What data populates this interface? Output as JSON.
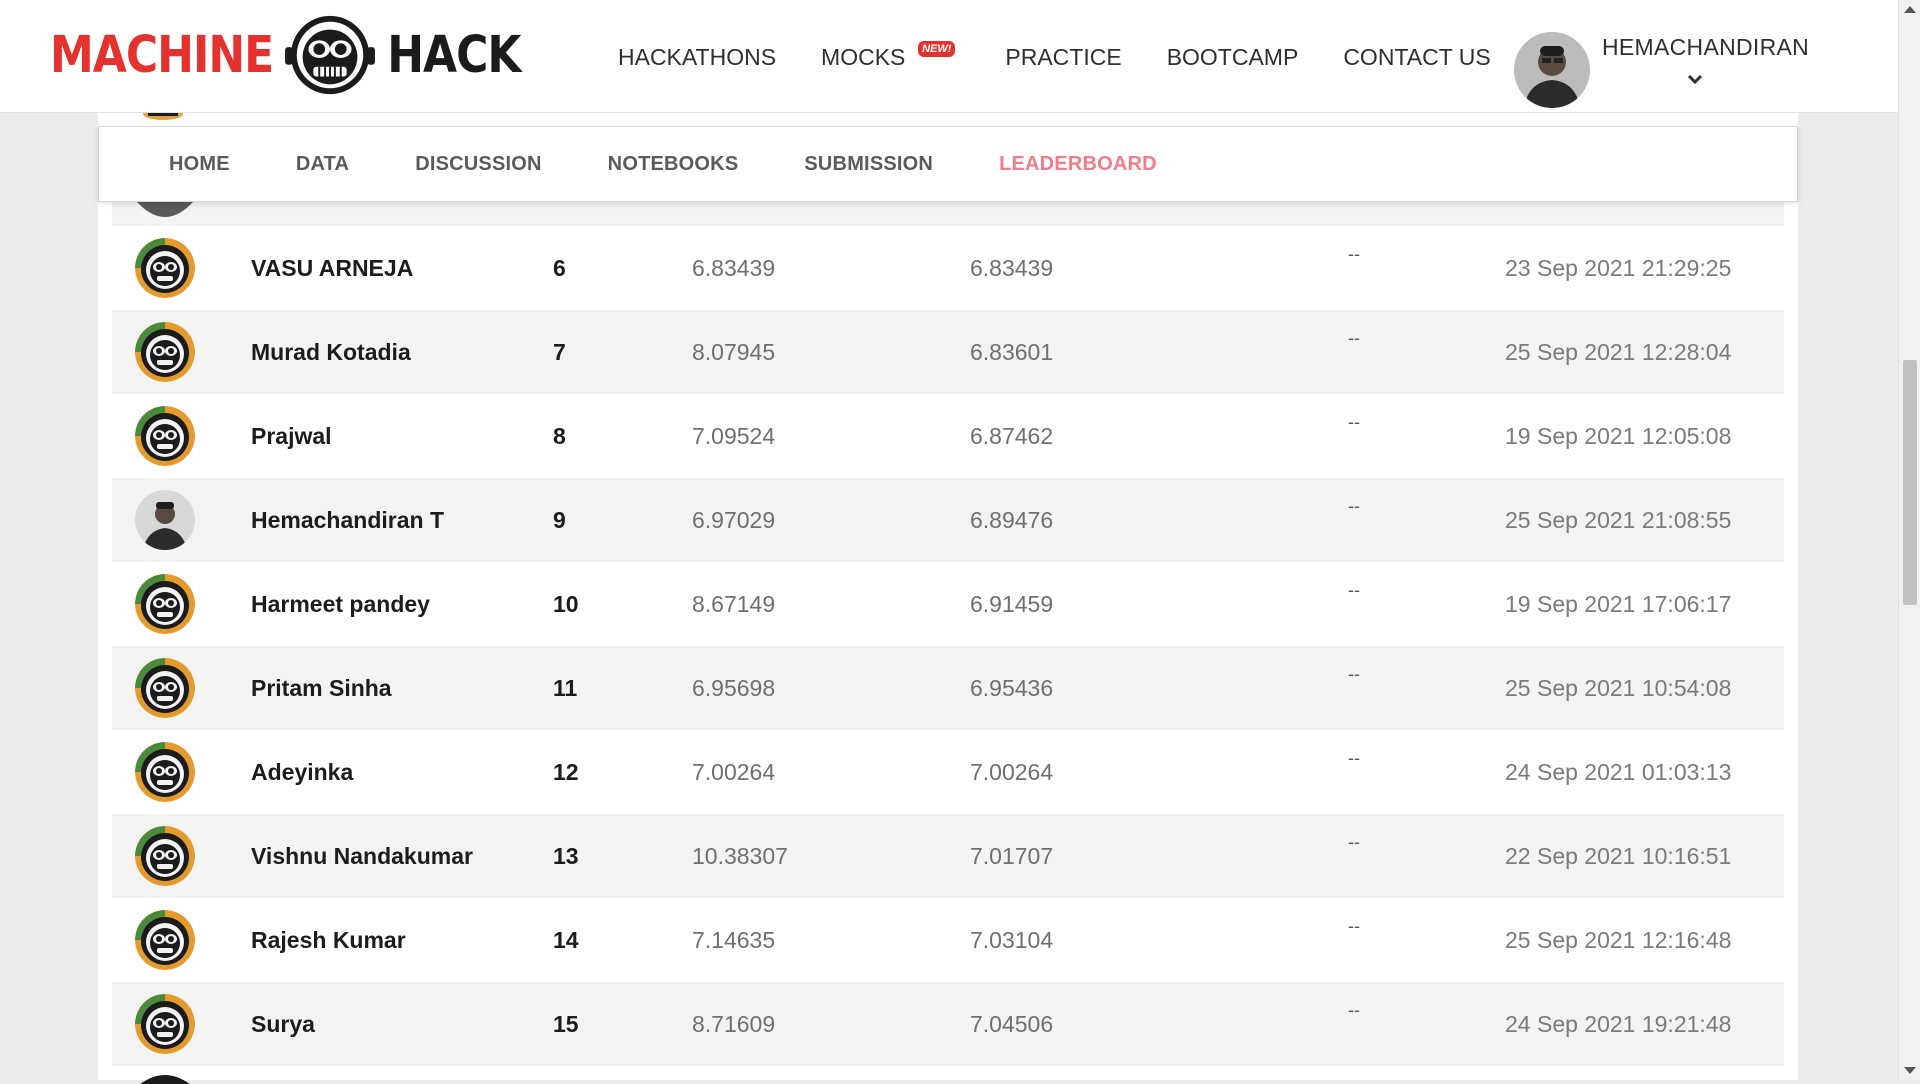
{
  "brand": {
    "name_left": "MACHINE",
    "name_right": "HACK"
  },
  "nav": {
    "items": [
      "HACKATHONS",
      "MOCKS",
      "PRACTICE",
      "BOOTCAMP",
      "CONTACT US"
    ],
    "mocks_badge": "NEW!"
  },
  "user": {
    "name": "HEMACHANDIRAN"
  },
  "tabs": {
    "items": [
      "HOME",
      "DATA",
      "DISCUSSION",
      "NOTEBOOKS",
      "SUBMISSION",
      "LEADERBOARD"
    ],
    "active": "LEADERBOARD"
  },
  "leaderboard": {
    "rows": [
      {
        "name": "VASU ARNEJA",
        "rank": "6",
        "public_score": "6.83439",
        "private_score": "6.83439",
        "notebook": "--",
        "submitted": "23 Sep 2021 21:29:25",
        "avatar": "mh-default-avatar"
      },
      {
        "name": "Murad Kotadia",
        "rank": "7",
        "public_score": "8.07945",
        "private_score": "6.83601",
        "notebook": "--",
        "submitted": "25 Sep 2021 12:28:04",
        "avatar": "mh-default-avatar"
      },
      {
        "name": "Prajwal",
        "rank": "8",
        "public_score": "7.09524",
        "private_score": "6.87462",
        "notebook": "--",
        "submitted": "19 Sep 2021 12:05:08",
        "avatar": "mh-default-avatar"
      },
      {
        "name": "Hemachandiran T",
        "rank": "9",
        "public_score": "6.97029",
        "private_score": "6.89476",
        "notebook": "--",
        "submitted": "25 Sep 2021 21:08:55",
        "avatar": "user-photo"
      },
      {
        "name": "Harmeet pandey",
        "rank": "10",
        "public_score": "8.67149",
        "private_score": "6.91459",
        "notebook": "--",
        "submitted": "19 Sep 2021 17:06:17",
        "avatar": "mh-default-avatar"
      },
      {
        "name": "Pritam Sinha",
        "rank": "11",
        "public_score": "6.95698",
        "private_score": "6.95436",
        "notebook": "--",
        "submitted": "25 Sep 2021 10:54:08",
        "avatar": "mh-default-avatar"
      },
      {
        "name": "Adeyinka",
        "rank": "12",
        "public_score": "7.00264",
        "private_score": "7.00264",
        "notebook": "--",
        "submitted": "24 Sep 2021 01:03:13",
        "avatar": "mh-default-avatar"
      },
      {
        "name": "Vishnu Nandakumar",
        "rank": "13",
        "public_score": "10.38307",
        "private_score": "7.01707",
        "notebook": "--",
        "submitted": "22 Sep 2021 10:16:51",
        "avatar": "mh-default-avatar"
      },
      {
        "name": "Rajesh Kumar",
        "rank": "14",
        "public_score": "7.14635",
        "private_score": "7.03104",
        "notebook": "--",
        "submitted": "25 Sep 2021 12:16:48",
        "avatar": "mh-default-avatar"
      },
      {
        "name": "Surya",
        "rank": "15",
        "public_score": "8.71609",
        "private_score": "7.04506",
        "notebook": "--",
        "submitted": "24 Sep 2021 19:21:48",
        "avatar": "mh-default-avatar"
      }
    ]
  },
  "colors": {
    "brand_red": "#e4322e",
    "active_tab": "#f07b8a",
    "row_alt": "#f3f3f3"
  }
}
